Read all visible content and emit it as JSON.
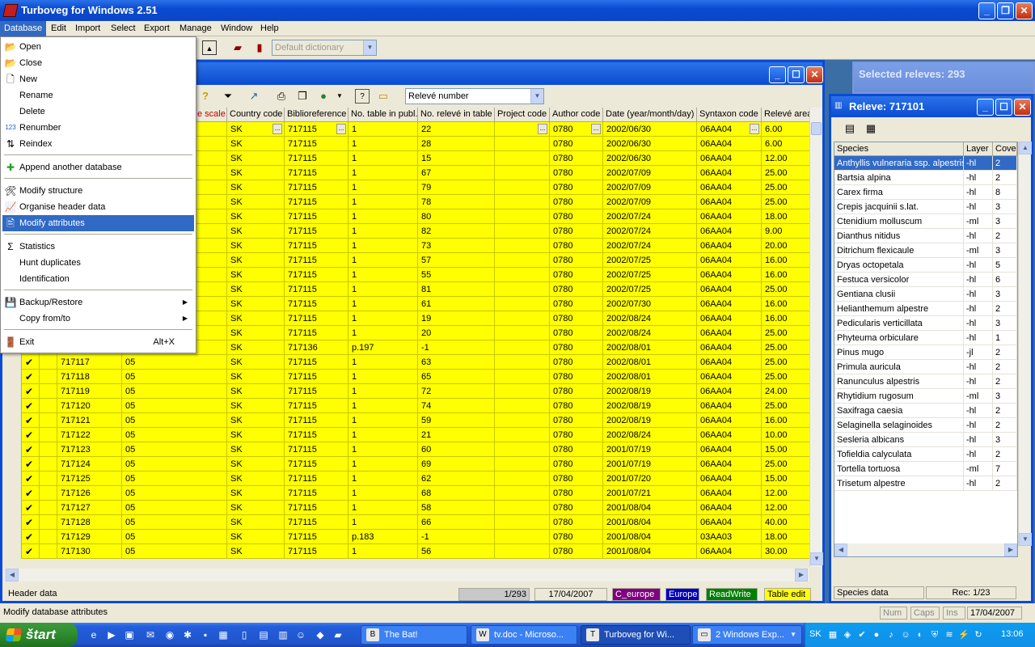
{
  "app": {
    "title": "Turboveg for Windows 2.51",
    "min_label": "_",
    "max_label": "❐",
    "close_label": "✕"
  },
  "menubar": [
    "Database",
    "Edit",
    "Import",
    "Select",
    "Export",
    "Manage",
    "Window",
    "Help"
  ],
  "toolbar": {
    "dictionary_placeholder": "Default dictionary"
  },
  "database_menu": {
    "items": [
      {
        "label": "Open",
        "icon": "open-folder-icon",
        "glyph": "📂"
      },
      {
        "label": "Close",
        "icon": "close-folder-icon",
        "glyph": "📂"
      },
      {
        "label": "New",
        "icon": "new-file-icon",
        "glyph": "🗋"
      },
      {
        "label": "Rename",
        "icon": "",
        "glyph": ""
      },
      {
        "label": "Delete",
        "icon": "",
        "glyph": ""
      },
      {
        "label": "Renumber",
        "icon": "renumber-icon",
        "glyph": "123"
      },
      {
        "label": "Reindex",
        "icon": "reindex-icon",
        "glyph": "⇅"
      },
      {
        "label": "Append another database",
        "icon": "append-icon",
        "glyph": "✚"
      },
      {
        "label": "Modify structure",
        "icon": "modify-structure-icon",
        "glyph": "🛠"
      },
      {
        "label": "Organise header data",
        "icon": "organise-header-icon",
        "glyph": "📈"
      },
      {
        "label": "Modify attributes",
        "icon": "modify-attributes-icon",
        "glyph": "🖹"
      },
      {
        "label": "Statistics",
        "icon": "statistics-icon",
        "glyph": "Σ"
      },
      {
        "label": "Hunt duplicates",
        "icon": "",
        "glyph": ""
      },
      {
        "label": "Identification",
        "icon": "",
        "glyph": ""
      },
      {
        "label": "Backup/Restore",
        "icon": "backup-icon",
        "glyph": "💾"
      },
      {
        "label": "Copy from/to",
        "icon": "",
        "glyph": ""
      },
      {
        "label": "Exit",
        "icon": "exit-icon",
        "glyph": "🚪"
      }
    ],
    "exit_shortcut": "Alt+X",
    "submenu_arrow": "▶"
  },
  "main_window": {
    "sort_combo": "Relevé number",
    "columns": [
      "e scale",
      "Country code",
      "Biblioreference",
      "No. table in publ.",
      "No. relevé in table",
      "Project code",
      "Author code",
      "Date (year/month/day)",
      "Syntaxon code",
      "Relevé area"
    ],
    "rows": [
      {
        "relnum": "",
        "scale": "",
        "country": "SK",
        "biblio": "717115",
        "table": "1",
        "releve": "22",
        "author": "0780",
        "date": "2002/06/30",
        "syntax": "06AA04",
        "area": "6.00"
      },
      {
        "relnum": "",
        "scale": "",
        "country": "SK",
        "biblio": "717115",
        "table": "1",
        "releve": "28",
        "author": "0780",
        "date": "2002/06/30",
        "syntax": "06AA04",
        "area": "6.00"
      },
      {
        "relnum": "",
        "scale": "",
        "country": "SK",
        "biblio": "717115",
        "table": "1",
        "releve": "15",
        "author": "0780",
        "date": "2002/06/30",
        "syntax": "06AA04",
        "area": "12.00"
      },
      {
        "relnum": "",
        "scale": "",
        "country": "SK",
        "biblio": "717115",
        "table": "1",
        "releve": "67",
        "author": "0780",
        "date": "2002/07/09",
        "syntax": "06AA04",
        "area": "25.00"
      },
      {
        "relnum": "",
        "scale": "",
        "country": "SK",
        "biblio": "717115",
        "table": "1",
        "releve": "79",
        "author": "0780",
        "date": "2002/07/09",
        "syntax": "06AA04",
        "area": "25.00"
      },
      {
        "relnum": "",
        "scale": "",
        "country": "SK",
        "biblio": "717115",
        "table": "1",
        "releve": "78",
        "author": "0780",
        "date": "2002/07/09",
        "syntax": "06AA04",
        "area": "25.00"
      },
      {
        "relnum": "",
        "scale": "",
        "country": "SK",
        "biblio": "717115",
        "table": "1",
        "releve": "80",
        "author": "0780",
        "date": "2002/07/24",
        "syntax": "06AA04",
        "area": "18.00"
      },
      {
        "relnum": "",
        "scale": "",
        "country": "SK",
        "biblio": "717115",
        "table": "1",
        "releve": "82",
        "author": "0780",
        "date": "2002/07/24",
        "syntax": "06AA04",
        "area": "9.00"
      },
      {
        "relnum": "",
        "scale": "",
        "country": "SK",
        "biblio": "717115",
        "table": "1",
        "releve": "73",
        "author": "0780",
        "date": "2002/07/24",
        "syntax": "06AA04",
        "area": "20.00"
      },
      {
        "relnum": "",
        "scale": "",
        "country": "SK",
        "biblio": "717115",
        "table": "1",
        "releve": "57",
        "author": "0780",
        "date": "2002/07/25",
        "syntax": "06AA04",
        "area": "16.00"
      },
      {
        "relnum": "",
        "scale": "",
        "country": "SK",
        "biblio": "717115",
        "table": "1",
        "releve": "55",
        "author": "0780",
        "date": "2002/07/25",
        "syntax": "06AA04",
        "area": "16.00"
      },
      {
        "relnum": "",
        "scale": "",
        "country": "SK",
        "biblio": "717115",
        "table": "1",
        "releve": "81",
        "author": "0780",
        "date": "2002/07/25",
        "syntax": "06AA04",
        "area": "25.00"
      },
      {
        "relnum": "",
        "scale": "",
        "country": "SK",
        "biblio": "717115",
        "table": "1",
        "releve": "61",
        "author": "0780",
        "date": "2002/07/30",
        "syntax": "06AA04",
        "area": "16.00"
      },
      {
        "relnum": "",
        "scale": "",
        "country": "SK",
        "biblio": "717115",
        "table": "1",
        "releve": "19",
        "author": "0780",
        "date": "2002/08/24",
        "syntax": "06AA04",
        "area": "16.00"
      },
      {
        "relnum": "",
        "scale": "",
        "country": "SK",
        "biblio": "717115",
        "table": "1",
        "releve": "20",
        "author": "0780",
        "date": "2002/08/24",
        "syntax": "06AA04",
        "area": "25.00"
      },
      {
        "relnum": "",
        "scale": "",
        "country": "SK",
        "biblio": "717136",
        "table": "p.197",
        "releve": "-1",
        "author": "0780",
        "date": "2002/08/01",
        "syntax": "06AA04",
        "area": "25.00"
      },
      {
        "relnum": "717117",
        "scale": "05",
        "country": "SK",
        "biblio": "717115",
        "table": "1",
        "releve": "63",
        "author": "0780",
        "date": "2002/08/01",
        "syntax": "06AA04",
        "area": "25.00"
      },
      {
        "relnum": "717118",
        "scale": "05",
        "country": "SK",
        "biblio": "717115",
        "table": "1",
        "releve": "65",
        "author": "0780",
        "date": "2002/08/01",
        "syntax": "06AA04",
        "area": "25.00"
      },
      {
        "relnum": "717119",
        "scale": "05",
        "country": "SK",
        "biblio": "717115",
        "table": "1",
        "releve": "72",
        "author": "0780",
        "date": "2002/08/19",
        "syntax": "06AA04",
        "area": "24.00"
      },
      {
        "relnum": "717120",
        "scale": "05",
        "country": "SK",
        "biblio": "717115",
        "table": "1",
        "releve": "74",
        "author": "0780",
        "date": "2002/08/19",
        "syntax": "06AA04",
        "area": "25.00"
      },
      {
        "relnum": "717121",
        "scale": "05",
        "country": "SK",
        "biblio": "717115",
        "table": "1",
        "releve": "59",
        "author": "0780",
        "date": "2002/08/19",
        "syntax": "06AA04",
        "area": "16.00"
      },
      {
        "relnum": "717122",
        "scale": "05",
        "country": "SK",
        "biblio": "717115",
        "table": "1",
        "releve": "21",
        "author": "0780",
        "date": "2002/08/24",
        "syntax": "06AA04",
        "area": "10.00"
      },
      {
        "relnum": "717123",
        "scale": "05",
        "country": "SK",
        "biblio": "717115",
        "table": "1",
        "releve": "60",
        "author": "0780",
        "date": "2001/07/19",
        "syntax": "06AA04",
        "area": "15.00"
      },
      {
        "relnum": "717124",
        "scale": "05",
        "country": "SK",
        "biblio": "717115",
        "table": "1",
        "releve": "69",
        "author": "0780",
        "date": "2001/07/19",
        "syntax": "06AA04",
        "area": "25.00"
      },
      {
        "relnum": "717125",
        "scale": "05",
        "country": "SK",
        "biblio": "717115",
        "table": "1",
        "releve": "62",
        "author": "0780",
        "date": "2001/07/20",
        "syntax": "06AA04",
        "area": "15.00"
      },
      {
        "relnum": "717126",
        "scale": "05",
        "country": "SK",
        "biblio": "717115",
        "table": "1",
        "releve": "68",
        "author": "0780",
        "date": "2001/07/21",
        "syntax": "06AA04",
        "area": "12.00"
      },
      {
        "relnum": "717127",
        "scale": "05",
        "country": "SK",
        "biblio": "717115",
        "table": "1",
        "releve": "58",
        "author": "0780",
        "date": "2001/08/04",
        "syntax": "06AA04",
        "area": "12.00"
      },
      {
        "relnum": "717128",
        "scale": "05",
        "country": "SK",
        "biblio": "717115",
        "table": "1",
        "releve": "66",
        "author": "0780",
        "date": "2001/08/04",
        "syntax": "06AA04",
        "area": "40.00"
      },
      {
        "relnum": "717129",
        "scale": "05",
        "country": "SK",
        "biblio": "717115",
        "table": "p.183",
        "releve": "-1",
        "author": "0780",
        "date": "2001/08/04",
        "syntax": "03AA03",
        "area": "18.00"
      },
      {
        "relnum": "717130",
        "scale": "05",
        "country": "SK",
        "biblio": "717115",
        "table": "1",
        "releve": "56",
        "author": "0780",
        "date": "2001/08/04",
        "syntax": "06AA04",
        "area": "30.00"
      }
    ],
    "checkmark": "✔",
    "status": {
      "header": "Header data",
      "position": "1/293",
      "date": "17/04/2007",
      "c_europe": "C_europe",
      "europe": "Europe",
      "readwrite": "ReadWrite",
      "table_edit": "Table edit"
    }
  },
  "selected_releves": {
    "title": "Selected releves: 293"
  },
  "releve_window": {
    "title": "Releve: 717101",
    "columns": [
      "Species",
      "Layer",
      "Cover"
    ],
    "species": [
      {
        "name": "Anthyllis vulneraria ssp. alpestris",
        "layer": "-hl",
        "cover": "2"
      },
      {
        "name": "Bartsia alpina",
        "layer": "-hl",
        "cover": "2"
      },
      {
        "name": "Carex firma",
        "layer": "-hl",
        "cover": "8"
      },
      {
        "name": "Crepis jacquinii s.lat.",
        "layer": "-hl",
        "cover": "3"
      },
      {
        "name": "Ctenidium molluscum",
        "layer": "-ml",
        "cover": "3"
      },
      {
        "name": "Dianthus nitidus",
        "layer": "-hl",
        "cover": "2"
      },
      {
        "name": "Ditrichum flexicaule",
        "layer": "-ml",
        "cover": "3"
      },
      {
        "name": "Dryas octopetala",
        "layer": "-hl",
        "cover": "5"
      },
      {
        "name": "Festuca versicolor",
        "layer": "-hl",
        "cover": "6"
      },
      {
        "name": "Gentiana clusii",
        "layer": "-hl",
        "cover": "3"
      },
      {
        "name": "Helianthemum alpestre",
        "layer": "-hl",
        "cover": "2"
      },
      {
        "name": "Pedicularis verticillata",
        "layer": "-hl",
        "cover": "3"
      },
      {
        "name": "Phyteuma orbiculare",
        "layer": "-hl",
        "cover": "1"
      },
      {
        "name": "Pinus mugo",
        "layer": "-jl",
        "cover": "2"
      },
      {
        "name": "Primula auricula",
        "layer": "-hl",
        "cover": "2"
      },
      {
        "name": "Ranunculus alpestris",
        "layer": "-hl",
        "cover": "2"
      },
      {
        "name": "Rhytidium rugosum",
        "layer": "-ml",
        "cover": "3"
      },
      {
        "name": "Saxifraga caesia",
        "layer": "-hl",
        "cover": "2"
      },
      {
        "name": "Selaginella selaginoides",
        "layer": "-hl",
        "cover": "2"
      },
      {
        "name": "Sesleria albicans",
        "layer": "-hl",
        "cover": "3"
      },
      {
        "name": "Tofieldia calyculata",
        "layer": "-hl",
        "cover": "2"
      },
      {
        "name": "Tortella tortuosa",
        "layer": "-ml",
        "cover": "7"
      },
      {
        "name": "Trisetum alpestre",
        "layer": "-hl",
        "cover": "2"
      }
    ],
    "status": {
      "label": "Species data",
      "rec": "Rec: 1/23"
    }
  },
  "status_bar": {
    "hint": "Modify database attributes",
    "num": "Num",
    "caps": "Caps",
    "ins": "Ins",
    "date": "17/04/2007"
  },
  "taskbar": {
    "start": "štart",
    "tasks": [
      "The Bat!",
      "tv.doc - Microso...",
      "Turboveg for Wi...",
      "2 Windows Exp..."
    ],
    "lang": "SK",
    "clock": "13:06"
  },
  "colors": {
    "row_yellow": "#ffff00",
    "selection_blue": "#316ac5",
    "xp_title": "#0a4bd3",
    "mdi_bg": "#3a6ea5"
  }
}
